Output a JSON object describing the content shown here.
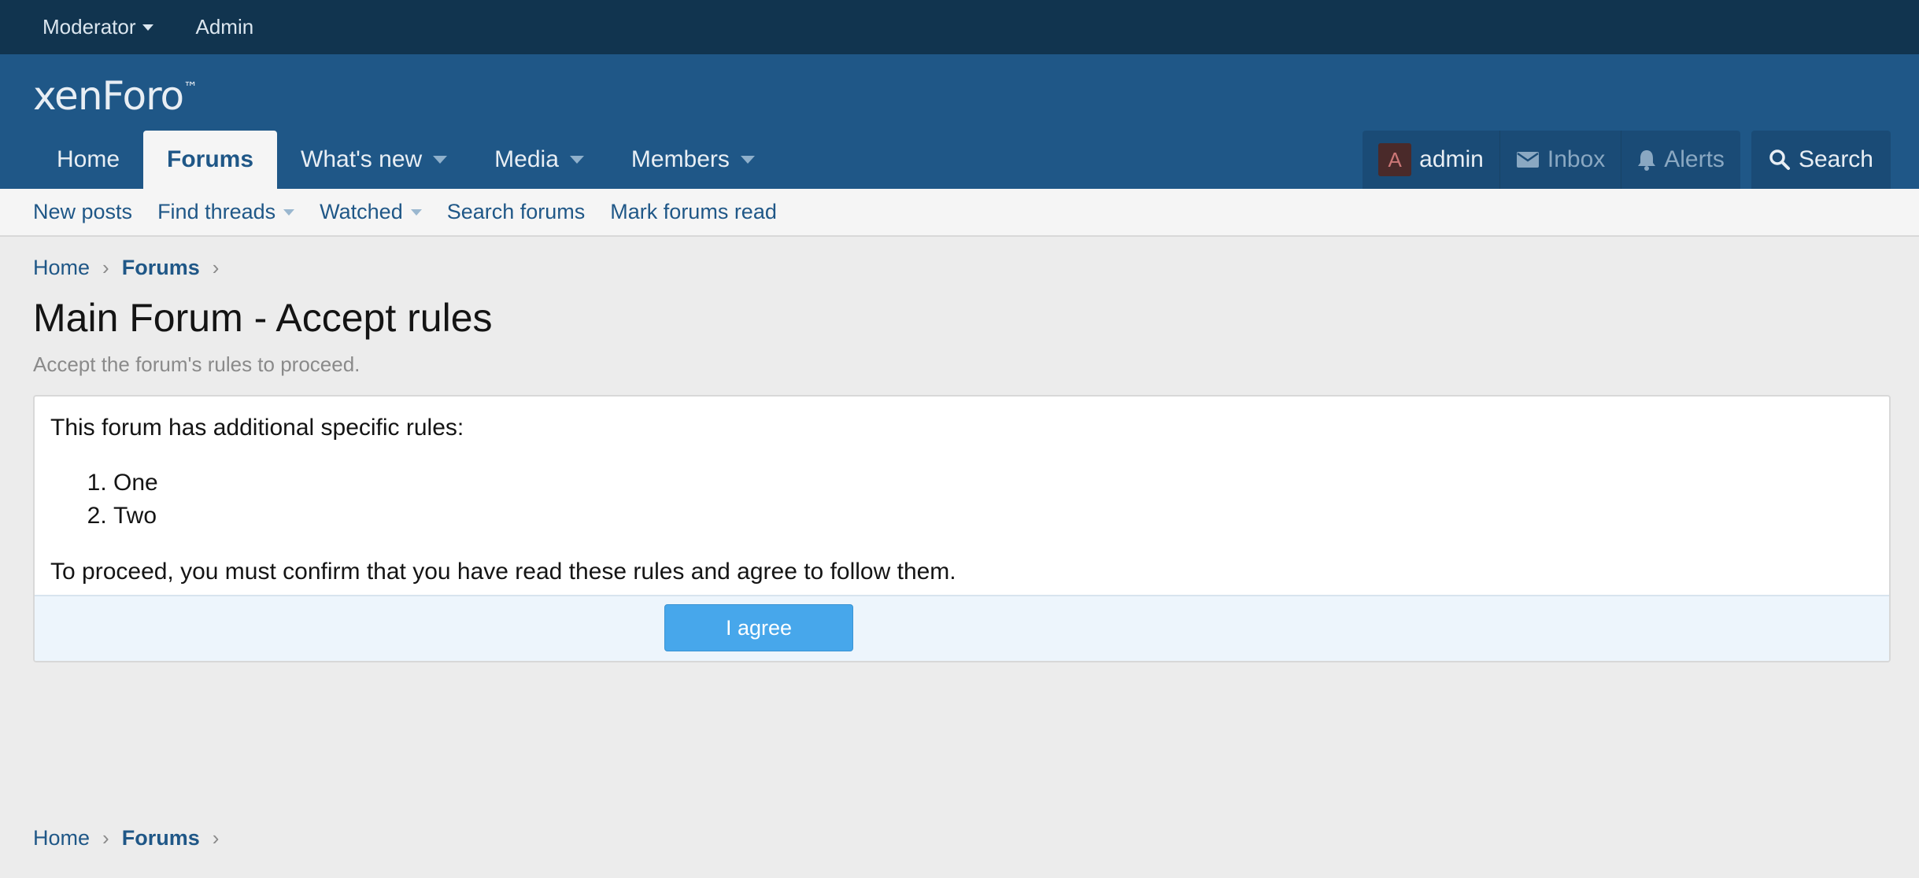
{
  "staff_bar": {
    "moderator": "Moderator",
    "admin": "Admin"
  },
  "header": {
    "logo_text": "xenForo",
    "logo_tm": "™"
  },
  "nav": {
    "tabs": [
      {
        "label": "Home",
        "has_menu": false,
        "active": false
      },
      {
        "label": "Forums",
        "has_menu": false,
        "active": true
      },
      {
        "label": "What's new",
        "has_menu": true,
        "active": false
      },
      {
        "label": "Media",
        "has_menu": true,
        "active": false
      },
      {
        "label": "Members",
        "has_menu": true,
        "active": false
      }
    ]
  },
  "user_nav": {
    "avatar_letter": "A",
    "username": "admin",
    "inbox": "Inbox",
    "alerts": "Alerts",
    "search": "Search"
  },
  "sub_nav": {
    "new_posts": "New posts",
    "find_threads": "Find threads",
    "watched": "Watched",
    "search_forums": "Search forums",
    "mark_read": "Mark forums read"
  },
  "breadcrumb": {
    "home": "Home",
    "forums": "Forums",
    "separator": "›"
  },
  "page": {
    "title": "Main Forum - Accept rules",
    "description": "Accept the forum's rules to proceed."
  },
  "rules": {
    "intro": "This forum has additional specific rules:",
    "items": [
      "One",
      "Two"
    ],
    "confirm_text": "To proceed, you must confirm that you have read these rules and agree to follow them.",
    "agree_label": "I agree"
  },
  "colors": {
    "staff_bar": "#11344f",
    "header": "#1f5787",
    "accent_button": "#47a7eb"
  }
}
